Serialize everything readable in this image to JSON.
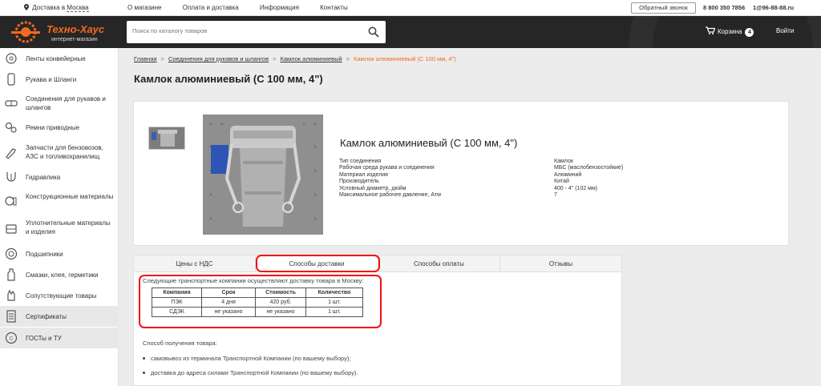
{
  "topbar": {
    "city_prefix": "Доставка в",
    "city": "Москва",
    "nav": [
      "О магазине",
      "Оплата и доставка",
      "Информация",
      "Контакты"
    ],
    "callback": "Обратный звонок",
    "phone": "8 800 350 7856",
    "email": "1@96-88-88.ru"
  },
  "header": {
    "logo_name": "Техно-Хаус",
    "logo_sub": "интернет-магазин",
    "search_placeholder": "Поиск по каталогу товаров",
    "cart_label": "Корзина",
    "cart_count": "4",
    "login": "Войти",
    "brand_color": "#f26a21"
  },
  "sidebar": {
    "items": [
      {
        "label": "Ленты конвейерные",
        "icon": "conveyor-belt-icon"
      },
      {
        "label": "Рукава и Шланги",
        "icon": "hose-icon"
      },
      {
        "label": "Соединения для рукавов и шлангов",
        "icon": "coupling-icon"
      },
      {
        "label": "Ремни приводные",
        "icon": "belt-drive-icon"
      },
      {
        "label": "Запчасти для бензовозов, АЗС и топливохранилищ",
        "icon": "fuel-nozzle-icon"
      },
      {
        "label": "Гидравлика",
        "icon": "hydraulics-icon"
      },
      {
        "label": "Конструкционные материалы",
        "icon": "materials-icon"
      },
      {
        "label": "Уплотнительные материалы и изделия",
        "icon": "seal-icon"
      },
      {
        "label": "Подшипники",
        "icon": "bearing-icon"
      },
      {
        "label": "Смазки, клея, герметики",
        "icon": "lubricant-icon"
      },
      {
        "label": "Сопутствующие товары",
        "icon": "hand-icon"
      },
      {
        "label": "Сертификаты",
        "icon": "certificate-icon"
      },
      {
        "label": "ГОСТы и ТУ",
        "icon": "gost-icon"
      }
    ]
  },
  "breadcrumb": {
    "items": [
      "Главная",
      "Соединения для рукавов и шлангов",
      "Камлок алюминиевый"
    ],
    "current": "Камлок алюминиевый (С 100 мм, 4\")"
  },
  "product": {
    "page_title": "Камлок алюминиевый (С 100 мм, 4\")",
    "title": "Камлок алюминиевый (С 100 мм, 4\")",
    "specs": [
      {
        "key": "Тип соединения",
        "value": "Камлок"
      },
      {
        "key": "Рабочая среда рукава и соединения",
        "value": "МБС (маслобензостойкие)"
      },
      {
        "key": "Материал изделия",
        "value": "Алюминий"
      },
      {
        "key": "Производитель",
        "value": "Китай"
      },
      {
        "key": "Условный диаметр, дюйм",
        "value": "400 - 4\" (102 мм)"
      },
      {
        "key": "Максимальное рабочее давление, Атм",
        "value": "7"
      }
    ]
  },
  "tabs": {
    "items": [
      "Цены с НДС",
      "Способы доставки",
      "Способы оплаты",
      "Отзывы"
    ],
    "active_index": 1
  },
  "shipping": {
    "intro": "Следующие транспортные компании осуществляют доставку товара в Москву:",
    "headers": [
      "Компания",
      "Срок",
      "Стоимость",
      "Количество"
    ],
    "rows": [
      [
        "ПЭК",
        "4 дня",
        "420 руб.",
        "1 шт."
      ],
      [
        "СДЭК",
        "не указано",
        "не указано",
        "1 шт."
      ]
    ],
    "receive_title": "Способ получения товара:",
    "receive_items": [
      "самовывоз из терминала Транспортной Компании (по вашему выбору);",
      "доставка до адреса силами Транспортной Компании (по вашему выбору)."
    ]
  }
}
